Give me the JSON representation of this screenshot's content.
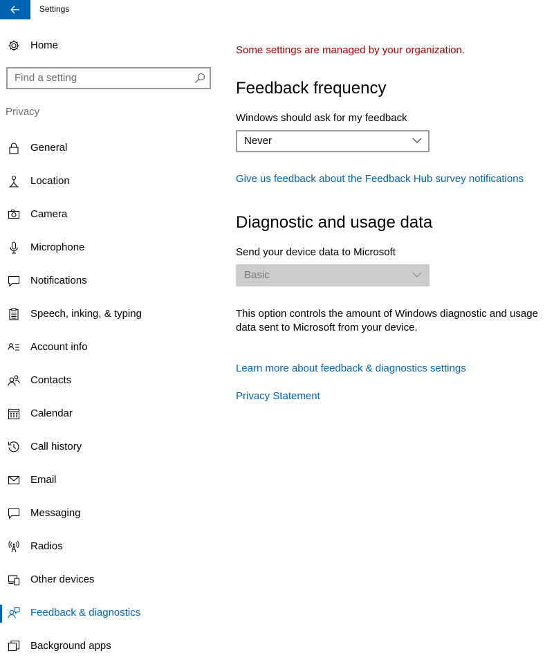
{
  "window": {
    "title": "Settings"
  },
  "sidebar": {
    "home_label": "Home",
    "search_placeholder": "Find a setting",
    "section_label": "Privacy",
    "items": [
      {
        "label": "General",
        "icon": "lock-icon"
      },
      {
        "label": "Location",
        "icon": "location-icon"
      },
      {
        "label": "Camera",
        "icon": "camera-icon"
      },
      {
        "label": "Microphone",
        "icon": "microphone-icon"
      },
      {
        "label": "Notifications",
        "icon": "notifications-icon"
      },
      {
        "label": "Speech, inking, & typing",
        "icon": "clipboard-icon"
      },
      {
        "label": "Account info",
        "icon": "account-info-icon"
      },
      {
        "label": "Contacts",
        "icon": "contacts-icon"
      },
      {
        "label": "Calendar",
        "icon": "calendar-icon"
      },
      {
        "label": "Call history",
        "icon": "history-icon"
      },
      {
        "label": "Email",
        "icon": "email-icon"
      },
      {
        "label": "Messaging",
        "icon": "messaging-icon"
      },
      {
        "label": "Radios",
        "icon": "radios-icon"
      },
      {
        "label": "Other devices",
        "icon": "devices-icon"
      },
      {
        "label": "Feedback & diagnostics",
        "icon": "feedback-icon",
        "selected": true
      },
      {
        "label": "Background apps",
        "icon": "background-apps-icon"
      }
    ]
  },
  "main": {
    "managed_notice": "Some settings are managed by your organization.",
    "feedback_heading": "Feedback frequency",
    "feedback_label": "Windows should ask for my feedback",
    "feedback_value": "Never",
    "feedback_link": "Give us feedback about the Feedback Hub survey notifications",
    "diag_heading": "Diagnostic and usage data",
    "diag_label": "Send your device data to Microsoft",
    "diag_value": "Basic",
    "diag_description": "This option controls the amount of Windows diagnostic and usage data sent to Microsoft from your device.",
    "learn_more_link": "Learn more about feedback & diagnostics settings",
    "privacy_link": "Privacy Statement"
  },
  "colors": {
    "accent": "#0063b1",
    "warning": "#a80000",
    "disabled_fill": "#cccccc"
  }
}
